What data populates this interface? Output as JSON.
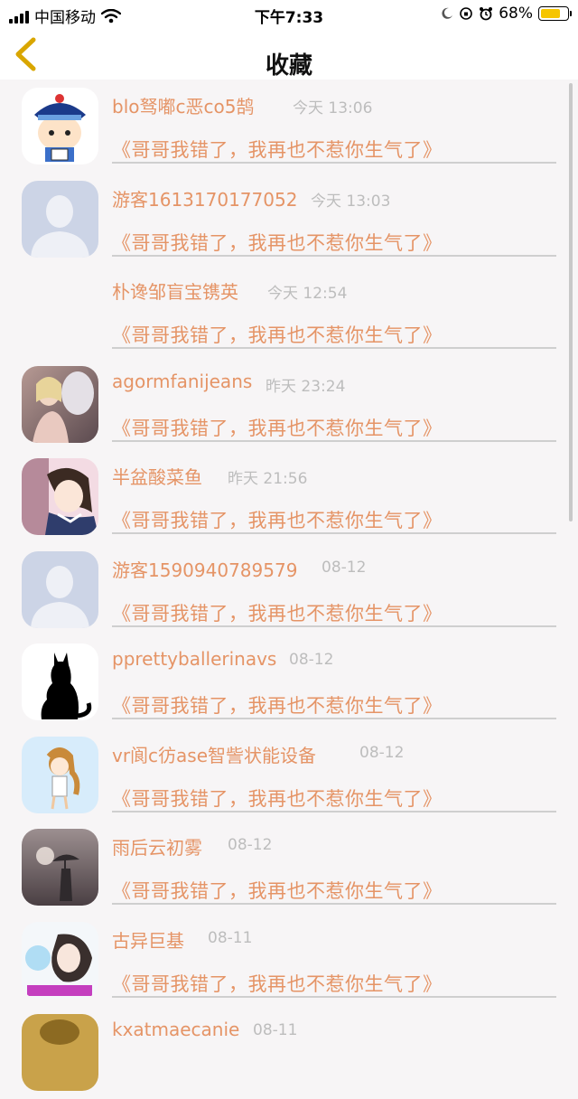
{
  "status_bar": {
    "carrier": "中国移动",
    "time": "下午7:33",
    "battery_percent": "68%",
    "battery_level": 0.68,
    "colors": {
      "battery_fill": "#f6c500"
    }
  },
  "nav": {
    "title": "收藏",
    "back_icon": "chevron-left-icon",
    "back_color": "#d9a600"
  },
  "colors": {
    "username": "#e59466",
    "link": "#e59466",
    "time": "#bdbdbd",
    "divider": "#cfcfcf"
  },
  "favorites": [
    {
      "username": "blo驽嘟c恶co5鹄",
      "time": "今天 13:06",
      "title": "《哥哥我错了，我再也不惹你生气了》",
      "avatar": "cartoon-boy-avatar"
    },
    {
      "username": "游客1613170177052",
      "time": "今天 13:03",
      "title": "《哥哥我错了，我再也不惹你生气了》",
      "avatar": "default-user-avatar"
    },
    {
      "username": "朴谗邹盲宝镌英",
      "time": "今天 12:54",
      "title": "《哥哥我错了，我再也不惹你生气了》",
      "avatar": ""
    },
    {
      "username": "agormfanijeans",
      "time": "昨天 23:24",
      "title": "《哥哥我错了，我再也不惹你生气了》",
      "avatar": "photo-girl-horse-avatar"
    },
    {
      "username": "半盆酸菜鱼",
      "time": "昨天 21:56",
      "title": "《哥哥我错了，我再也不惹你生气了》",
      "avatar": "anime-girl-avatar"
    },
    {
      "username": "游客1590940789579",
      "time": "08-12",
      "title": "《哥哥我错了，我再也不惹你生气了》",
      "avatar": "default-user-avatar"
    },
    {
      "username": "pprettyballerinavs",
      "time": "08-12",
      "title": "《哥哥我错了，我再也不惹你生气了》",
      "avatar": "black-cat-avatar"
    },
    {
      "username": "vr阆c彷ase智訾状能设备",
      "time": "08-12",
      "title": "《哥哥我错了，我再也不惹你生气了》",
      "avatar": "cartoon-girl-avatar"
    },
    {
      "username": "雨后云初雾",
      "time": "08-12",
      "title": "《哥哥我错了，我再也不惹你生气了》",
      "avatar": "umbrella-photo-avatar"
    },
    {
      "username": "古异巨基",
      "time": "08-11",
      "title": "《哥哥我错了，我再也不惹你生气了》",
      "avatar": "bubble-girl-avatar"
    },
    {
      "username": "kxatmaecanie",
      "time": "08-11",
      "title": "",
      "avatar": "gold-avatar"
    }
  ]
}
